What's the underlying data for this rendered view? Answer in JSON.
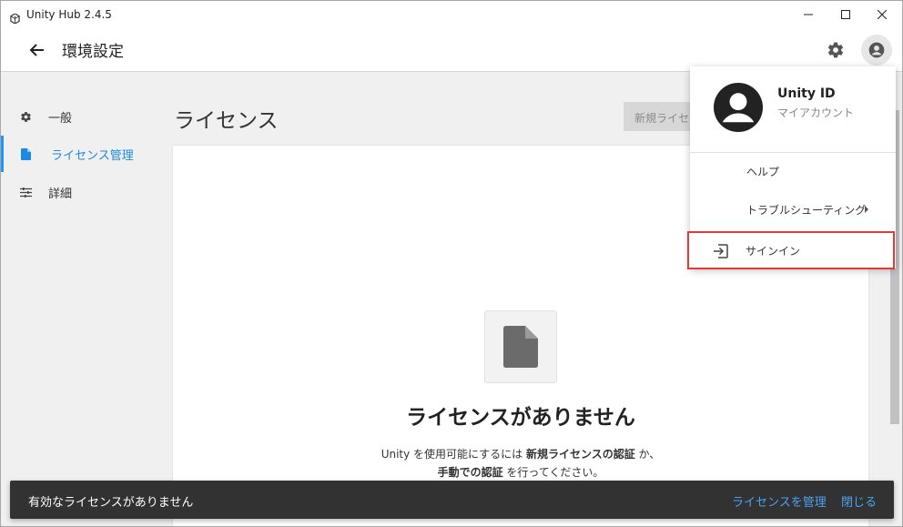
{
  "window": {
    "title": "Unity Hub 2.4.5"
  },
  "header": {
    "title": "環境設定"
  },
  "sidebar": {
    "items": [
      {
        "label": "一般",
        "icon": "gear-icon"
      },
      {
        "label": "ライセンス管理",
        "icon": "document-icon",
        "active": true
      },
      {
        "label": "詳細",
        "icon": "sliders-icon"
      }
    ]
  },
  "main": {
    "title": "ライセンス",
    "new_license_button": "新規ライセ",
    "empty": {
      "title": "ライセンスがありません",
      "desc_part1": "Unity を使用可能にするには ",
      "desc_bold1": "新規ライセンスの認証",
      "desc_part2": " か、",
      "desc_bold2": "手動での認証",
      "desc_part3": " を行ってください。"
    }
  },
  "account_menu": {
    "name": "Unity ID",
    "subtitle": "マイアカウント",
    "items": [
      {
        "label": "ヘルプ"
      },
      {
        "label": "トラブルシューティング",
        "has_submenu": true
      }
    ],
    "signin": "サインイン"
  },
  "snackbar": {
    "message": "有効なライセンスがありません",
    "action_manage": "ライセンスを管理",
    "action_close": "閉じる"
  },
  "colors": {
    "accent": "#2196f3",
    "highlight_border": "#e53935",
    "snackbar_bg": "#323232"
  }
}
